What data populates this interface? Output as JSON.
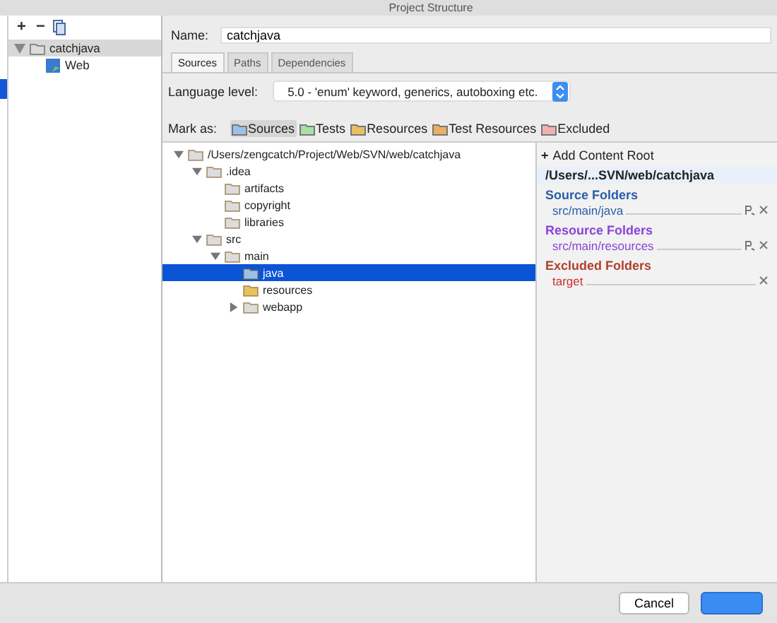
{
  "window": {
    "title": "Project Structure"
  },
  "module_toolbar": {
    "buttons": [
      "+",
      "−"
    ]
  },
  "modules": [
    {
      "name": "catchjava",
      "expanded": true,
      "selected": true,
      "children": [
        {
          "name": "Web",
          "selected": false
        }
      ]
    }
  ],
  "name_field": {
    "label": "Name:",
    "value": "catchjava"
  },
  "tabs": [
    {
      "label": "Sources",
      "selected": true
    },
    {
      "label": "Paths",
      "selected": false
    },
    {
      "label": "Dependencies",
      "selected": false
    }
  ],
  "language_level": {
    "label": "Language level:",
    "value": "5.0 - 'enum' keyword, generics, autoboxing etc."
  },
  "mark_as": {
    "label": "Mark as:",
    "buttons": [
      {
        "label": "Sources",
        "kind": "source",
        "selected": true
      },
      {
        "label": "Tests",
        "kind": "test",
        "selected": false
      },
      {
        "label": "Resources",
        "kind": "resource",
        "selected": false
      },
      {
        "label": "Test Resources",
        "kind": "test_resource",
        "selected": false
      },
      {
        "label": "Excluded",
        "kind": "excluded",
        "selected": false
      }
    ]
  },
  "tree": [
    {
      "name": "/Users/zengcatch/Project/Web/SVN/web/catchjava",
      "kind": "folder",
      "expanded": true,
      "selected": false,
      "children": [
        {
          "name": ".idea",
          "kind": "folder",
          "expanded": true,
          "selected": false,
          "children": [
            {
              "name": "artifacts",
              "kind": "folder",
              "selected": false
            },
            {
              "name": "copyright",
              "kind": "folder",
              "selected": false
            },
            {
              "name": "libraries",
              "kind": "folder",
              "selected": false
            }
          ]
        },
        {
          "name": "src",
          "kind": "folder",
          "expanded": true,
          "selected": false,
          "children": [
            {
              "name": "main",
              "kind": "folder",
              "expanded": true,
              "selected": false,
              "children": [
                {
                  "name": "java",
                  "kind": "source",
                  "selected": true
                },
                {
                  "name": "resources",
                  "kind": "resource",
                  "selected": false
                },
                {
                  "name": "webapp",
                  "kind": "folder",
                  "expanded": false,
                  "selected": false
                }
              ]
            }
          ]
        }
      ]
    }
  ],
  "content_root": {
    "add_icon": "+",
    "add_label": "Add Content Root",
    "path": "/Users/...SVN/web/catchjava",
    "groups": [
      {
        "title": "Source Folders",
        "color": "#2a5ea8",
        "entries": [
          {
            "path": "src/main/java",
            "kind": "source"
          }
        ]
      },
      {
        "title": "Resource Folders",
        "color": "#8a44d8",
        "entries": [
          {
            "path": "src/main/resources",
            "kind": "resource"
          }
        ]
      },
      {
        "title": "Excluded Folders",
        "color": "#b0402e",
        "entries": [
          {
            "path": "target",
            "kind": "excluded"
          }
        ]
      }
    ]
  },
  "dialog_buttons": [
    {
      "label": "Cancel",
      "default": false
    },
    {
      "default": true
    }
  ]
}
